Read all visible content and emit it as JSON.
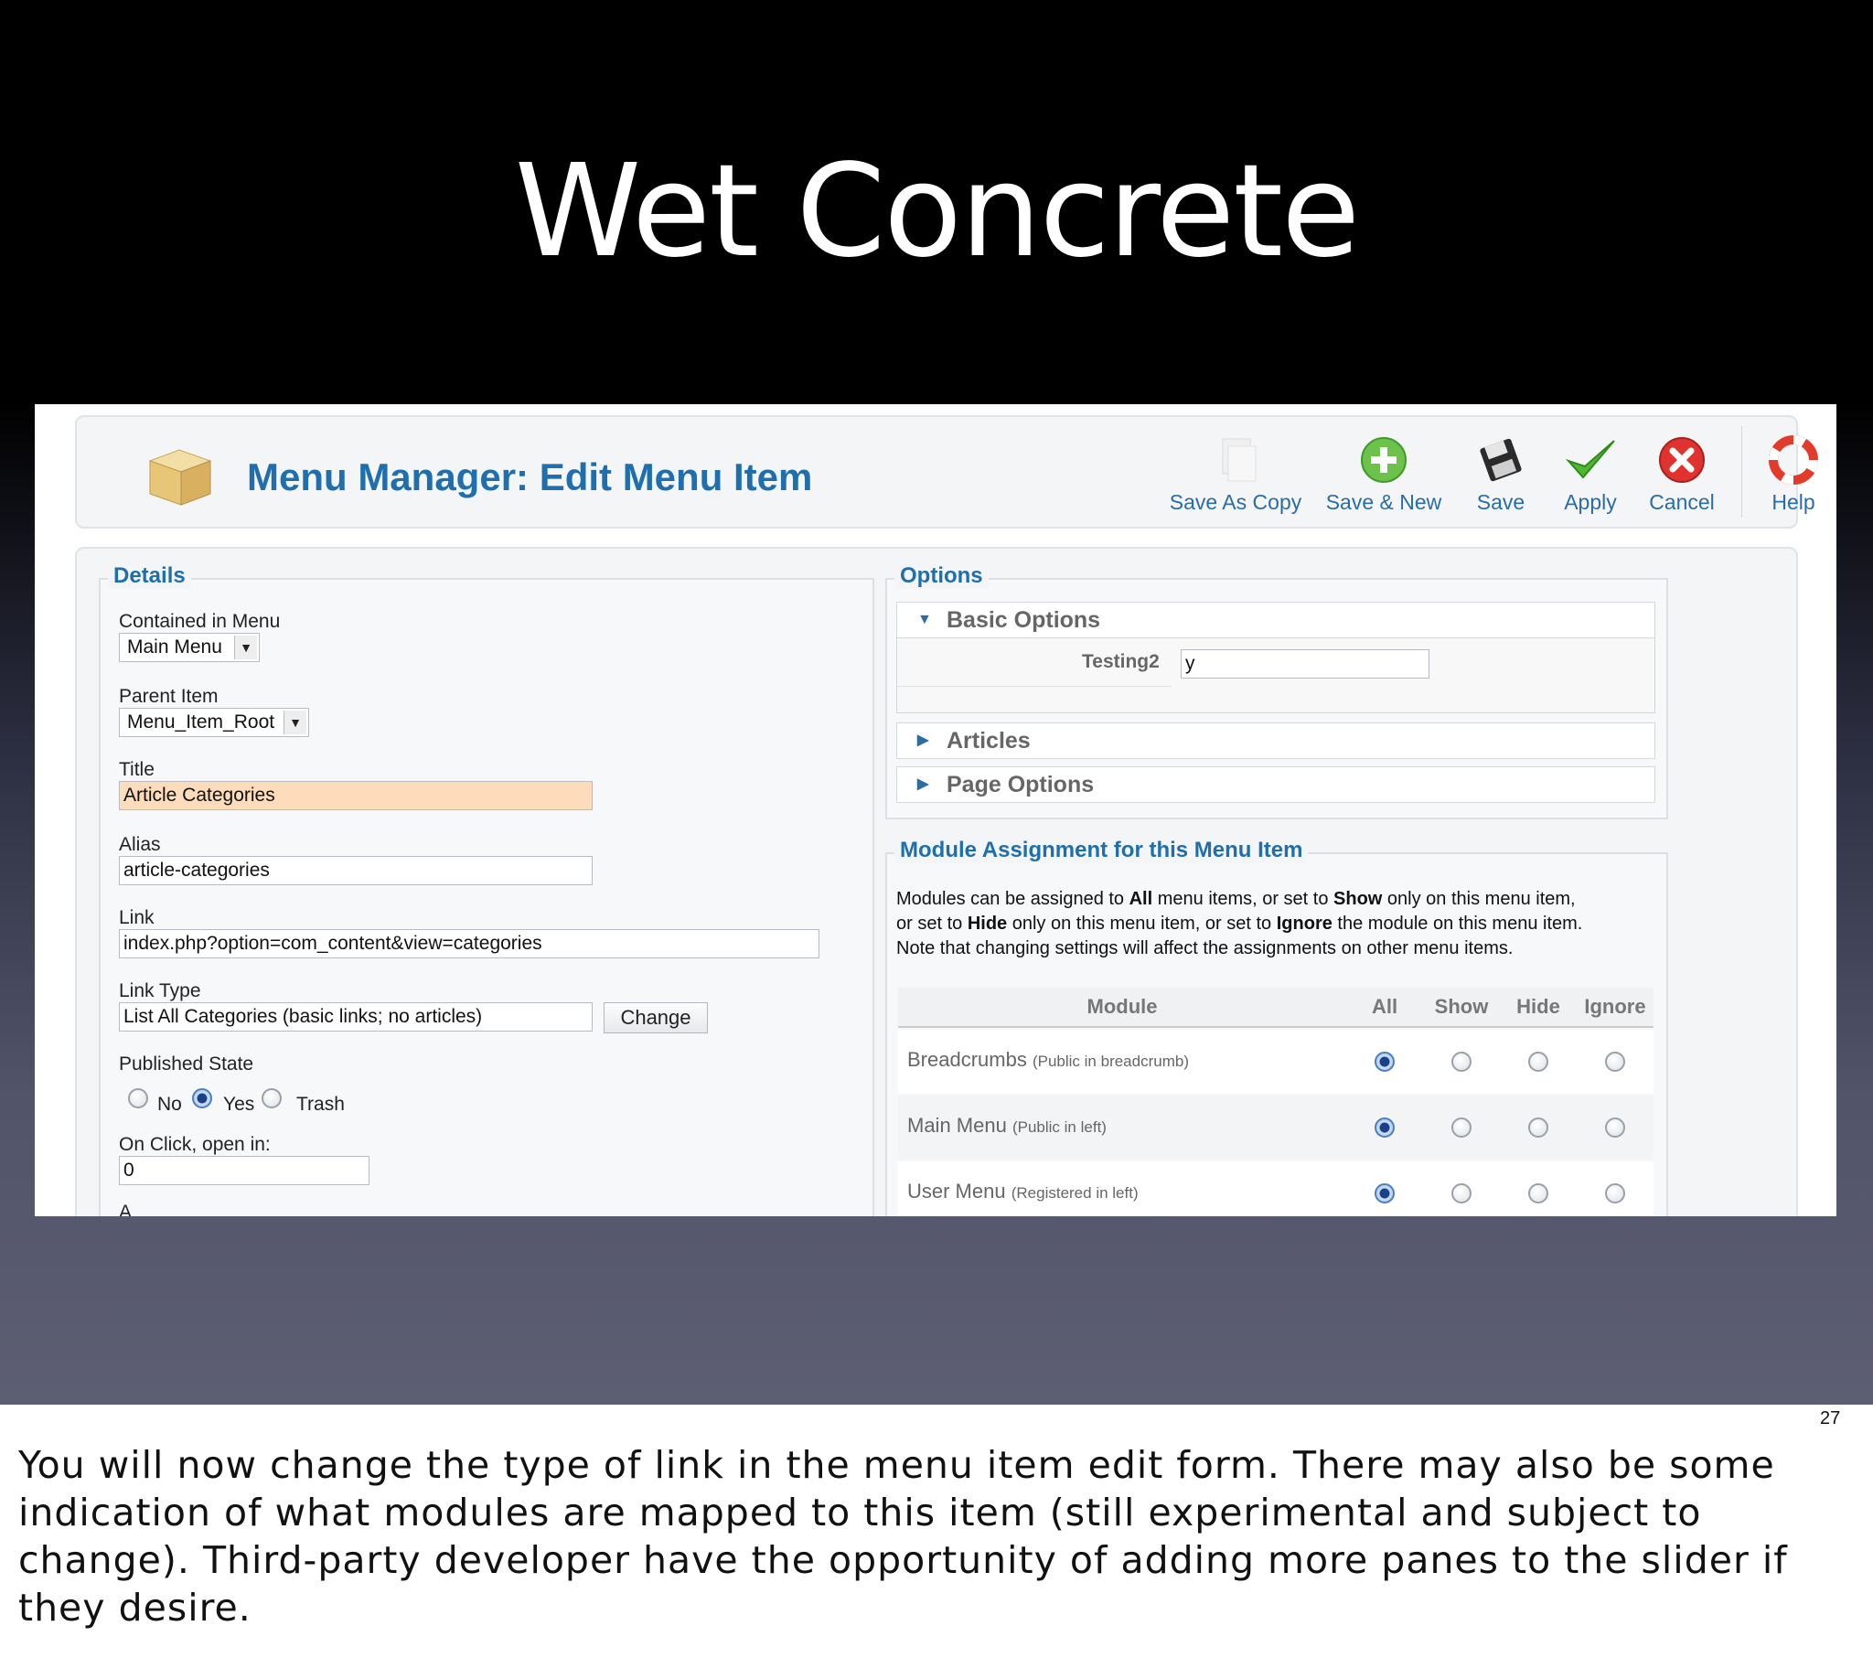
{
  "slide": {
    "title": "Wet Concrete",
    "number": "27",
    "notes": "You will now change the type of link in the menu item edit form.  There may also be some indication of what modules are mapped to this item (still experimental and subject to change).  Third-party developer have the opportunity of adding more panes to the slider if they desire."
  },
  "toolbar": {
    "heading": "Menu Manager: Edit Menu Item",
    "buttons": [
      {
        "label": "Save As Copy",
        "icon": "copy-icon"
      },
      {
        "label": "Save & New",
        "icon": "add-icon"
      },
      {
        "label": "Save",
        "icon": "floppy-icon"
      },
      {
        "label": "Apply",
        "icon": "checkmark-icon"
      },
      {
        "label": "Cancel",
        "icon": "cancel-icon"
      },
      {
        "label": "Help",
        "icon": "lifebuoy-icon"
      }
    ]
  },
  "details": {
    "legend": "Details",
    "contained_in_menu_label": "Contained in Menu",
    "contained_in_menu_value": "Main Menu",
    "parent_item_label": "Parent Item",
    "parent_item_value": "Menu_Item_Root",
    "title_label": "Title",
    "title_value": "Article Categories",
    "alias_label": "Alias",
    "alias_value": "article-categories",
    "link_label": "Link",
    "link_value": "index.php?option=com_content&view=categories",
    "link_type_label": "Link Type",
    "link_type_value": "List All Categories (basic links; no articles)",
    "change_button": "Change",
    "published_label": "Published State",
    "published_options": [
      "No",
      "Yes",
      "Trash"
    ],
    "published_selected": "Yes",
    "onclick_label": "On Click, open in:",
    "onclick_value": "0",
    "cutoff_text": "A"
  },
  "options": {
    "legend": "Options",
    "panes": [
      {
        "label": "Basic Options",
        "expanded": true
      },
      {
        "label": "Articles",
        "expanded": false
      },
      {
        "label": "Page Options",
        "expanded": false
      }
    ],
    "testing2_label": "Testing2",
    "testing2_value": "y"
  },
  "modules": {
    "legend": "Module Assignment for this Menu Item",
    "description_lines": [
      [
        "Modules can be assigned to ",
        "All",
        " menu items, or set to ",
        "Show",
        " only on this menu item,"
      ],
      [
        "or set to ",
        "Hide",
        " only on this menu item, or set to ",
        "Ignore",
        " the module on this menu item."
      ],
      [
        "Note that changing settings will affect the assignments on other menu items.",
        "",
        "",
        "",
        ""
      ]
    ],
    "columns": [
      "Module",
      "All",
      "Show",
      "Hide",
      "Ignore"
    ],
    "rows": [
      {
        "name": "Breadcrumbs",
        "detail": "(Public in breadcrumb)",
        "selected": "All"
      },
      {
        "name": "Main Menu",
        "detail": "(Public in left)",
        "selected": "All"
      },
      {
        "name": "User Menu",
        "detail": "(Registered in left)",
        "selected": "All"
      }
    ]
  },
  "colors": {
    "heading_blue": "#1f6fae",
    "title_highlight": "#fddcbc",
    "slide_background_top": "#000000",
    "slide_background_bottom": "#5d5e72"
  }
}
